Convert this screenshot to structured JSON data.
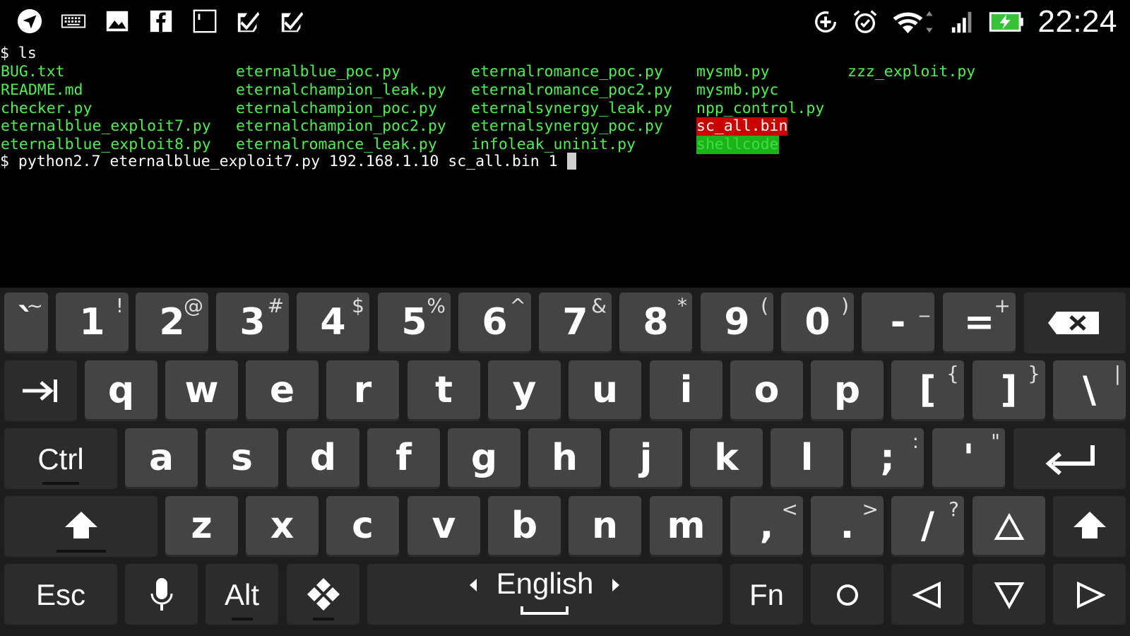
{
  "status_bar": {
    "left_icons": [
      "send-icon",
      "keyboard-icon",
      "image-icon",
      "facebook-icon",
      "terminal-icon",
      "task-check-icon",
      "task-check-icon"
    ],
    "right_icons": [
      "data-saver-icon",
      "alarm-icon",
      "wifi-icon",
      "signal-icon",
      "battery-charging-icon"
    ],
    "clock": "22:24"
  },
  "terminal": {
    "prompt1": "$ ls",
    "files": [
      [
        "BUG.txt",
        "eternalblue_poc.py",
        "eternalromance_poc.py",
        "mysmb.py",
        "zzz_exploit.py"
      ],
      [
        "README.md",
        "eternalchampion_leak.py",
        "eternalromance_poc2.py",
        "mysmb.pyc",
        ""
      ],
      [
        "checker.py",
        "eternalchampion_poc.py",
        "eternalsynergy_leak.py",
        "npp_control.py",
        ""
      ],
      [
        "eternalblue_exploit7.py",
        "eternalchampion_poc2.py",
        "eternalsynergy_poc.py",
        "sc_all.bin",
        ""
      ],
      [
        "eternalblue_exploit8.py",
        "eternalromance_leak.py",
        "infoleak_uninit.py",
        "shellcode",
        ""
      ]
    ],
    "command": "$ python2.7 eternalblue_exploit7.py 192.168.1.10 sc_all.bin 1 "
  },
  "keyboard": {
    "row1": [
      {
        "main": "`",
        "alt": "~"
      },
      {
        "main": "1",
        "alt": "!"
      },
      {
        "main": "2",
        "alt": "@"
      },
      {
        "main": "3",
        "alt": "#"
      },
      {
        "main": "4",
        "alt": "$"
      },
      {
        "main": "5",
        "alt": "%"
      },
      {
        "main": "6",
        "alt": "^"
      },
      {
        "main": "7",
        "alt": "&"
      },
      {
        "main": "8",
        "alt": "*"
      },
      {
        "main": "9",
        "alt": "("
      },
      {
        "main": "0",
        "alt": ")"
      },
      {
        "main": "-",
        "alt": "_"
      },
      {
        "main": "=",
        "alt": "+"
      }
    ],
    "row2": [
      {
        "main": "q",
        "alt": ""
      },
      {
        "main": "w",
        "alt": ""
      },
      {
        "main": "e",
        "alt": ""
      },
      {
        "main": "r",
        "alt": ""
      },
      {
        "main": "t",
        "alt": ""
      },
      {
        "main": "y",
        "alt": ""
      },
      {
        "main": "u",
        "alt": ""
      },
      {
        "main": "i",
        "alt": ""
      },
      {
        "main": "o",
        "alt": ""
      },
      {
        "main": "p",
        "alt": ""
      },
      {
        "main": "[",
        "alt": "{"
      },
      {
        "main": "]",
        "alt": "}"
      },
      {
        "main": "\\",
        "alt": "|"
      }
    ],
    "row3": [
      {
        "main": "a",
        "alt": ""
      },
      {
        "main": "s",
        "alt": ""
      },
      {
        "main": "d",
        "alt": ""
      },
      {
        "main": "f",
        "alt": ""
      },
      {
        "main": "g",
        "alt": ""
      },
      {
        "main": "h",
        "alt": ""
      },
      {
        "main": "j",
        "alt": ""
      },
      {
        "main": "k",
        "alt": ""
      },
      {
        "main": "l",
        "alt": ""
      },
      {
        "main": ";",
        "alt": ":"
      },
      {
        "main": "'",
        "alt": "\""
      }
    ],
    "row4": [
      {
        "main": "z",
        "alt": ""
      },
      {
        "main": "x",
        "alt": ""
      },
      {
        "main": "c",
        "alt": ""
      },
      {
        "main": "v",
        "alt": ""
      },
      {
        "main": "b",
        "alt": ""
      },
      {
        "main": "n",
        "alt": ""
      },
      {
        "main": "m",
        "alt": ""
      },
      {
        "main": ",",
        "alt": "<"
      },
      {
        "main": ".",
        "alt": ">"
      },
      {
        "main": "/",
        "alt": "?"
      }
    ],
    "ctrl_label": "Ctrl",
    "esc_label": "Esc",
    "alt_label": "Alt",
    "fn_label": "Fn",
    "language_label": "English"
  }
}
